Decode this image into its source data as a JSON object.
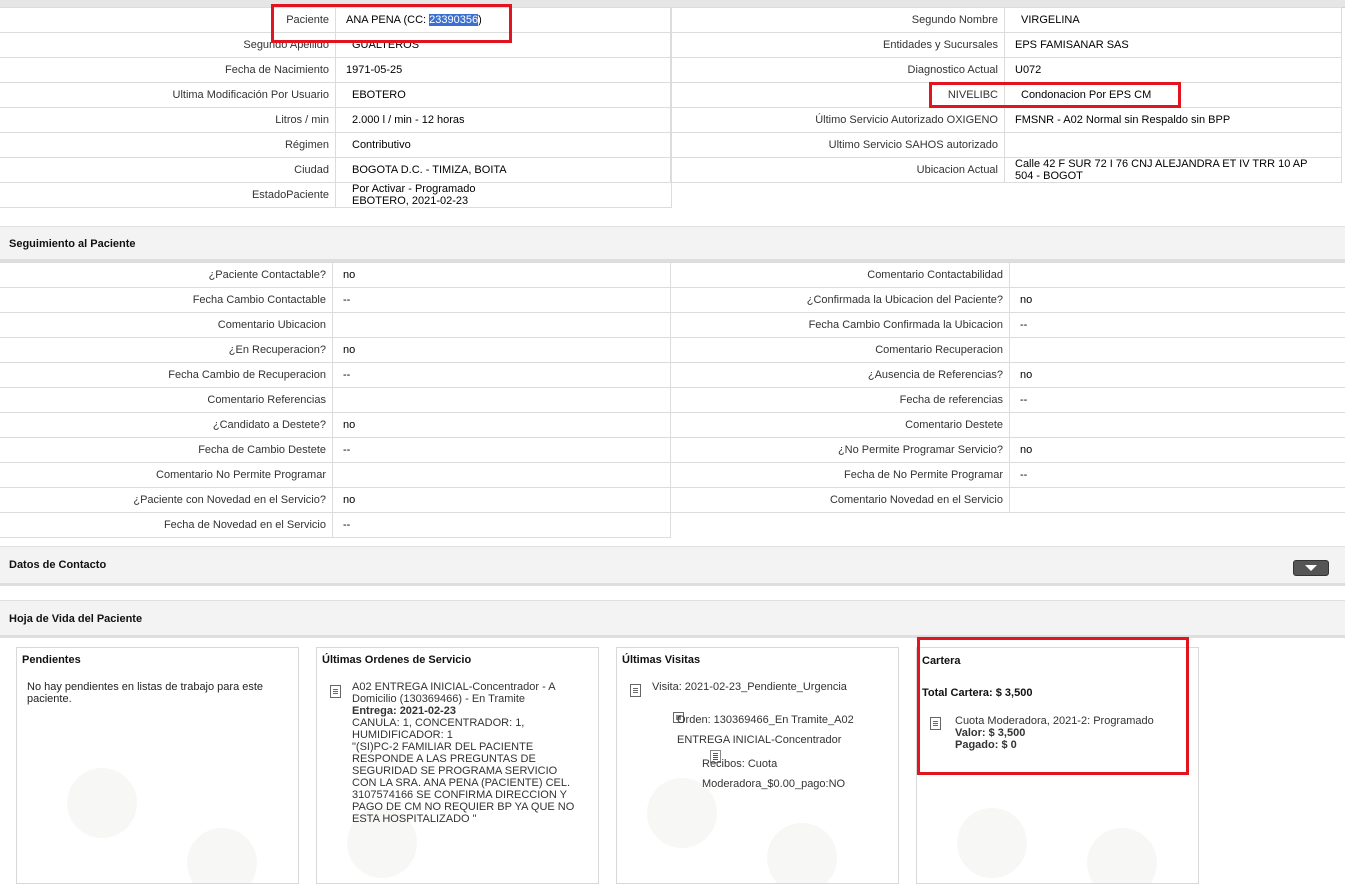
{
  "patient_info": {
    "left": [
      {
        "label": "Paciente",
        "value_prefix": "ANA PENA (CC: ",
        "value_highlight": "23390356",
        "value_suffix": ")"
      },
      {
        "label": "Segundo Apellido",
        "value": "GUALTEROS"
      },
      {
        "label": "Fecha de Nacimiento",
        "value": "1971-05-25"
      },
      {
        "label": "Ultima Modificación Por Usuario",
        "value": "EBOTERO"
      },
      {
        "label": "Litros / min",
        "value": "2.000 l / min - 12 horas"
      },
      {
        "label": "Régimen",
        "value": "Contributivo"
      },
      {
        "label": "Ciudad",
        "value": "BOGOTA D.C. - TIMIZA, BOITA"
      },
      {
        "label": "EstadoPaciente",
        "value_line1": "Por Activar - Programado",
        "value_line2": "EBOTERO, 2021-02-23"
      }
    ],
    "right": [
      {
        "label": "Segundo Nombre",
        "value": "VIRGELINA"
      },
      {
        "label": "Entidades y Sucursales",
        "value": "EPS FAMISANAR SAS"
      },
      {
        "label": "Diagnostico Actual",
        "value": "U072"
      },
      {
        "label": "NIVELIBC",
        "value": "Condonacion Por EPS CM"
      },
      {
        "label": "Último Servicio Autorizado OXIGENO",
        "value": "FMSNR - A02 Normal sin Respaldo sin BPP"
      },
      {
        "label": "Ultimo Servicio SAHOS autorizado",
        "value": ""
      },
      {
        "label": "Ubicacion Actual",
        "value_line1": "Calle 42 F SUR 72 I 76 CNJ ALEJANDRA ET IV TRR 10 AP",
        "value_line2": "504 - BOGOT"
      }
    ]
  },
  "seguimiento": {
    "title": "Seguimiento al Paciente",
    "left": [
      {
        "label": "¿Paciente Contactable?",
        "value": "no"
      },
      {
        "label": "Fecha Cambio Contactable",
        "value": "--"
      },
      {
        "label": "Comentario Ubicacion",
        "value": ""
      },
      {
        "label": "¿En Recuperacion?",
        "value": "no"
      },
      {
        "label": "Fecha Cambio de Recuperacion",
        "value": "--"
      },
      {
        "label": "Comentario Referencias",
        "value": ""
      },
      {
        "label": "¿Candidato a Destete?",
        "value": "no"
      },
      {
        "label": "Fecha de Cambio Destete",
        "value": "--"
      },
      {
        "label": "Comentario No Permite Programar",
        "value": ""
      },
      {
        "label": "¿Paciente con Novedad en el Servicio?",
        "value": "no"
      },
      {
        "label": "Fecha de Novedad en el Servicio",
        "value": "--"
      }
    ],
    "right": [
      {
        "label": "Comentario Contactabilidad",
        "value": ""
      },
      {
        "label": "¿Confirmada la Ubicacion del Paciente?",
        "value": "no"
      },
      {
        "label": "Fecha Cambio Confirmada la Ubicacion",
        "value": "--"
      },
      {
        "label": "Comentario Recuperacion",
        "value": ""
      },
      {
        "label": "¿Ausencia de Referencias?",
        "value": "no"
      },
      {
        "label": "Fecha de referencias",
        "value": "--"
      },
      {
        "label": "Comentario Destete",
        "value": ""
      },
      {
        "label": "¿No Permite Programar Servicio?",
        "value": "no"
      },
      {
        "label": "Fecha de No Permite Programar",
        "value": "--"
      },
      {
        "label": "Comentario Novedad en el Servicio",
        "value": ""
      }
    ]
  },
  "contacto": {
    "title": "Datos de Contacto"
  },
  "hoja_vida": {
    "title": "Hoja de Vida del Paciente",
    "pendientes": {
      "title": "Pendientes",
      "text": "No hay pendientes en listas de trabajo para este paciente."
    },
    "ordenes": {
      "title": "Últimas Ordenes de Servicio",
      "line1": "A02 ENTREGA INICIAL-Concentrador - A",
      "line2": "Domicilio (130369466) - En Tramite",
      "entrega_label": "Entrega:",
      "entrega_value": "2021-02-23",
      "detail_lines": [
        "CANULA: 1, CONCENTRADOR: 1,",
        "HUMIDIFICADOR: 1",
        "\"(SI)PC-2 FAMILIAR DEL PACIENTE",
        "RESPONDE A LAS PREGUNTAS DE",
        "SEGURIDAD SE PROGRAMA SERVICIO",
        "CON LA SRA. ANA PENA (PACIENTE) CEL.",
        "3107574166 SE CONFIRMA DIRECCION Y",
        "PAGO DE CM NO REQUIER BP YA QUE NO",
        "ESTA HOSPITALIZADO \""
      ]
    },
    "visitas": {
      "title": "Últimas Visitas",
      "visita": "Visita: 2021-02-23_Pendiente_Urgencia",
      "orden_line1": "Orden: 130369466_En Tramite_A02",
      "orden_line2": "ENTREGA INICIAL-Concentrador",
      "recibos_line1": "Recibos: Cuota",
      "recibos_line2": "Moderadora_$0.00_pago:NO"
    },
    "cartera": {
      "title": "Cartera",
      "total": "Total Cartera: $ 3,500",
      "item": "Cuota Moderadora, 2021-2: Programado",
      "valor": "Valor: $ 3,500",
      "pagado": "Pagado: $ 0"
    }
  },
  "annotation_color": "#e0151f"
}
